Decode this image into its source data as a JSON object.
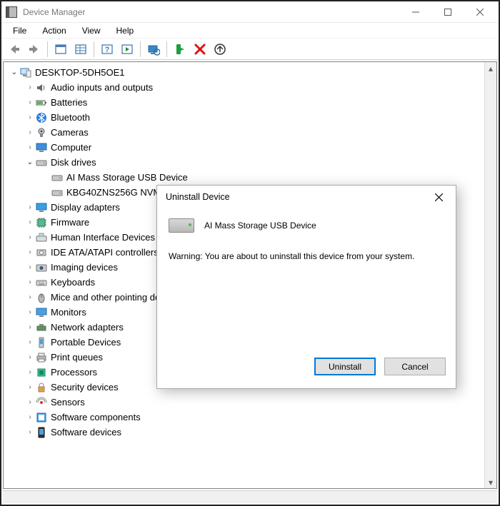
{
  "window": {
    "title": "Device Manager"
  },
  "menus": {
    "file": "File",
    "action": "Action",
    "view": "View",
    "help": "Help"
  },
  "tree": {
    "root": "DESKTOP-5DH5OE1",
    "audio": "Audio inputs and outputs",
    "batteries": "Batteries",
    "bluetooth": "Bluetooth",
    "cameras": "Cameras",
    "computer": "Computer",
    "diskdrives": "Disk drives",
    "disk_a": "AI Mass Storage USB Device",
    "disk_b": "KBG40ZNS256G NVMe KIOXIA 256GB",
    "display": "Display adapters",
    "firmware": "Firmware",
    "hid": "Human Interface Devices",
    "ide": "IDE ATA/ATAPI controllers",
    "imaging": "Imaging devices",
    "keyboards": "Keyboards",
    "mice": "Mice and other pointing devices",
    "monitors": "Monitors",
    "network": "Network adapters",
    "portable": "Portable Devices",
    "printq": "Print queues",
    "processors": "Processors",
    "security": "Security devices",
    "sensors": "Sensors",
    "software_comp": "Software components",
    "software_dev": "Software devices"
  },
  "dialog": {
    "title": "Uninstall Device",
    "device_name": "AI Mass Storage USB Device",
    "warning": "Warning: You are about to uninstall this device from your system.",
    "uninstall": "Uninstall",
    "cancel": "Cancel"
  }
}
